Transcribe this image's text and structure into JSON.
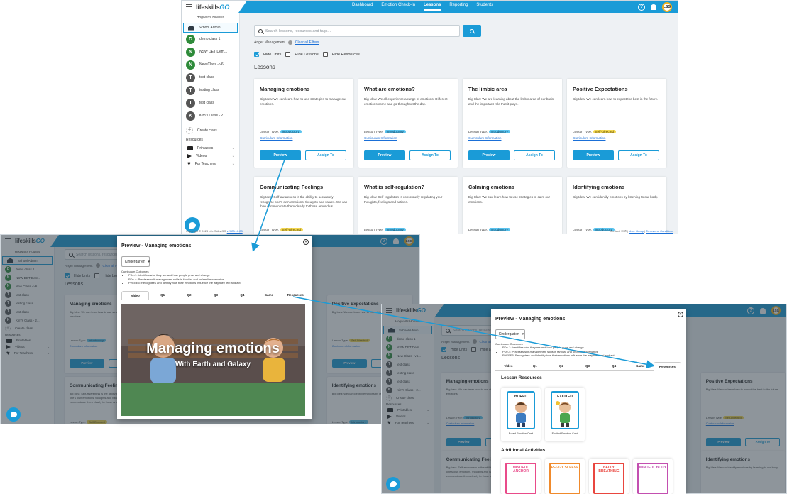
{
  "colors": {
    "brand": "#1a9bd7",
    "intro_tag": "#5ac3ee",
    "self_tag": "#f2d650",
    "link": "#1a6fd7"
  },
  "app": {
    "logo_life": "lifeskills",
    "logo_go": "GO",
    "nav": [
      "Dashboard",
      "Emotion Check-In",
      "Lessons",
      "Reporting",
      "Students"
    ],
    "active_nav": "Lessons",
    "avatar": "LSG",
    "help_icon": "?"
  },
  "sidebar": {
    "title": "Hogwarts Houses",
    "school": "School Admin",
    "classes": [
      {
        "initial": "D",
        "name": "demo class 1",
        "color": "green"
      },
      {
        "initial": "N",
        "name": "NSW DET Dem...",
        "color": "green"
      },
      {
        "initial": "N",
        "name": "New Class - v6...",
        "color": "green"
      },
      {
        "initial": "T",
        "name": "test class",
        "color": "gray"
      },
      {
        "initial": "T",
        "name": "testing class",
        "color": "gray"
      },
      {
        "initial": "T",
        "name": "test class",
        "color": "gray"
      },
      {
        "initial": "K",
        "name": "Kim's Class - 2...",
        "color": "gray"
      }
    ],
    "create_class": "Create class",
    "resources_heading": "Resources",
    "resources": [
      "Printables",
      "Videos",
      "For Teachers"
    ]
  },
  "search": {
    "placeholder": "Search lessons, resources and tags...",
    "filter_chip": "Anger Management",
    "clear_all": "Clear all Filters"
  },
  "checkboxes": {
    "hide_units": "Hide Units",
    "hide_lessons": "Hide Lessons",
    "hide_resources": "Hide Resources"
  },
  "lessons_heading": "Lessons",
  "lesson_type_label": "Lesson Type:",
  "curriculum_link": "Curriculum Information",
  "preview_label": "Preview",
  "assign_label": "Assign To",
  "cards_row1": [
    {
      "title": "Managing emotions",
      "desc": "Big Idea: We can learn how to use strategies to manage our emotions.",
      "type": "Introductory",
      "kind": "intro"
    },
    {
      "title": "What are emotions?",
      "desc": "Big Idea: We all experience a range of emotions. Different emotions come and go throughout the day.",
      "type": "Introductory",
      "kind": "intro"
    },
    {
      "title": "The limbic area",
      "desc": "Big Idea: We are learning about the limbic area of our brain and the important role that it plays.",
      "type": "Introductory",
      "kind": "intro"
    },
    {
      "title": "Positive Expectations",
      "desc": "Big Idea: We can learn how to expect the best in the future.",
      "type": "Self-Directed",
      "kind": "self"
    }
  ],
  "cards_row2": [
    {
      "title": "Communicating Feelings",
      "desc": "Big Idea: Self-awareness is the ability to accurately recognise one's own emotions, thoughts and values. We can then communicate them clearly to those around us.",
      "type": "Self-Directed",
      "kind": "self"
    },
    {
      "title": "What is self-regulation?",
      "desc": "Big Idea: Self-regulation is consciously regulating your thoughts, feelings and actions.",
      "type": "Introductory",
      "kind": "intro"
    },
    {
      "title": "Calming emotions",
      "desc": "Big Idea: We can learn how to use strategies to calm our emotions.",
      "type": "Introductory",
      "kind": "intro"
    },
    {
      "title": "Identifying emotions",
      "desc": "Big Idea: We can identify emotions by listening to our body.",
      "type": "Introductory",
      "kind": "intro"
    }
  ],
  "footer": {
    "copyright": "Copyright © 2023 Life Skills GO",
    "version": "v2023.10.23",
    "contact": "Contact:",
    "user_group": "User Group",
    "terms": "Terms and Conditions"
  },
  "modal": {
    "title": "Preview - Managing emotions",
    "grade": "Kindergarten",
    "outcomes_heading": "Curriculum Outcomes",
    "outcomes": [
      "PDe-1: Identifies who they are and how people grow and change",
      "PDe-4: Practises self-management skills in familiar and unfamiliar scenarios",
      "PHEEE5: Recognises and identify how their emotions influence the way they feel and act."
    ],
    "tabs": [
      "Video",
      "Q1",
      "Q2",
      "Q3",
      "Q4",
      "Game",
      "Resources"
    ],
    "video_title": "Managing emotions",
    "video_subtitle": "With Earth and Galaxy",
    "lesson_resources_heading": "Lesson Resources",
    "resources": [
      {
        "word": "BORED",
        "caption": "Bored Emotion Card"
      },
      {
        "word": "EXCITED",
        "caption": "Excited Emotion Card"
      }
    ],
    "additional_heading": "Additional Activities",
    "activities": [
      {
        "text": "MINDFUL ANCHOR",
        "color": "#e94b8a"
      },
      {
        "text": "PEGGY SLEEVE",
        "color": "#f08a2c"
      },
      {
        "text": "BELLY BREATHING",
        "color": "#e9463f"
      },
      {
        "text": "MINDFUL BODY",
        "color": "#c34fb0"
      }
    ]
  }
}
